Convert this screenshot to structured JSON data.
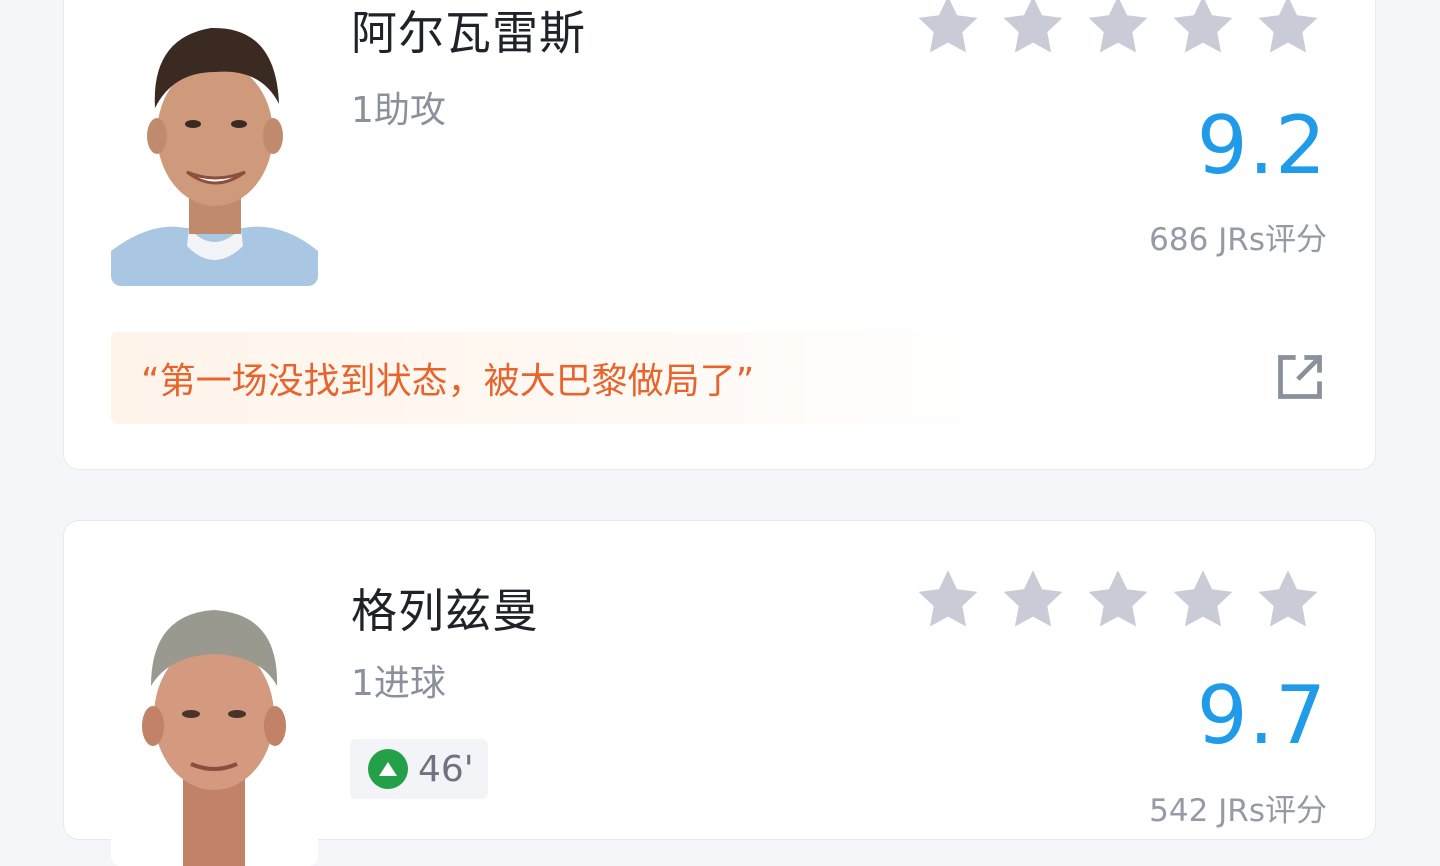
{
  "colors": {
    "score": "#1f9bea",
    "star_inactive": "#c9ccd6",
    "quote_text": "#e8642d",
    "sub_in": "#24a148"
  },
  "players": [
    {
      "name": "阿尔瓦雷斯",
      "stat": "1助攻",
      "rating_stars": 0,
      "score": "9.2",
      "votes": "686 JRs评分",
      "quote": "“第一场没找到状态，被大巴黎做局了”",
      "share_icon": "share-external-icon"
    },
    {
      "name": "格列兹曼",
      "stat": "1进球",
      "rating_stars": 0,
      "score": "9.7",
      "votes": "542 JRs评分",
      "substitution": {
        "icon": "sub-in-arrow-icon",
        "time": "46'"
      }
    }
  ]
}
